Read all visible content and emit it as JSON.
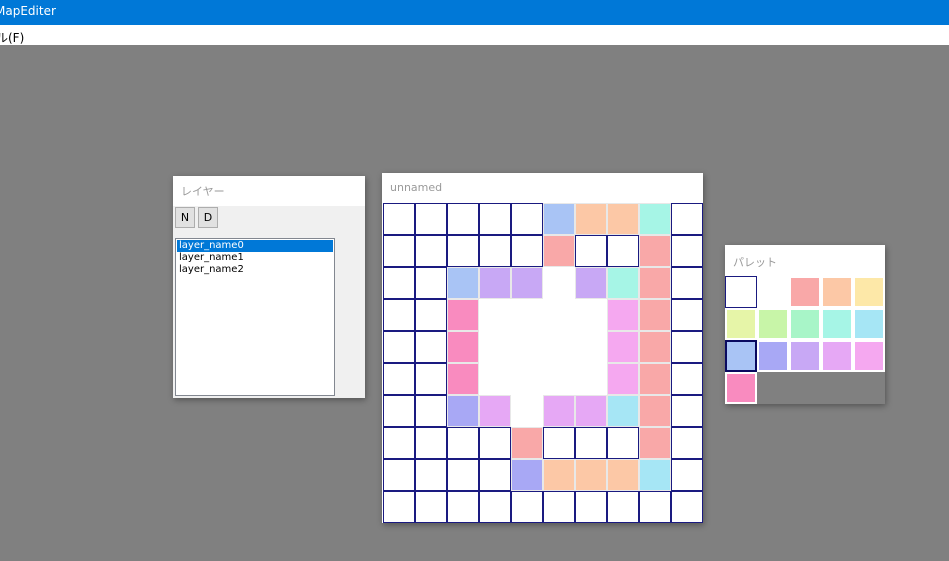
{
  "app": {
    "title": "MapEditer"
  },
  "menu": {
    "file_label": "ル(F)"
  },
  "layer_window": {
    "title": "レイヤー",
    "new_label": "N",
    "delete_label": "D",
    "layers": [
      "layer_name0",
      "layer_name1",
      "layer_name2"
    ],
    "selected_index": 0
  },
  "map_window": {
    "title": "unnamed",
    "grid": [
      [
        "#ffffff",
        "#ffffff",
        "#ffffff",
        "#ffffff",
        "#ffffff",
        "#a9c4f5",
        "#fcc8a6",
        "#fcc8a6",
        "#a6f5e6",
        "#ffffff"
      ],
      [
        "#ffffff",
        "#ffffff",
        "#ffffff",
        "#ffffff",
        "#ffffff",
        "#f9a8a8",
        "#ffffff",
        "#ffffff",
        "#f9a8a8",
        "#ffffff"
      ],
      [
        "#ffffff",
        "#ffffff",
        "#a9c4f5",
        "#c8a8f5",
        "#c8a8f5",
        null,
        "#c8a8f5",
        "#a6f5e6",
        "#f9a8a8",
        "#ffffff"
      ],
      [
        "#ffffff",
        "#ffffff",
        "#f98bbf",
        null,
        null,
        null,
        null,
        "#f5a8f0",
        "#f9a8a8",
        "#ffffff"
      ],
      [
        "#ffffff",
        "#ffffff",
        "#f98bbf",
        null,
        null,
        null,
        null,
        "#f5a8f0",
        "#f9a8a8",
        "#ffffff"
      ],
      [
        "#ffffff",
        "#ffffff",
        "#f98bbf",
        null,
        null,
        null,
        null,
        "#f5a8f0",
        "#f9a8a8",
        "#ffffff"
      ],
      [
        "#ffffff",
        "#ffffff",
        "#a8a8f5",
        "#e6a8f5",
        null,
        "#e6a8f5",
        "#e6a8f5",
        "#a6e6f5",
        "#f9a8a8",
        "#ffffff"
      ],
      [
        "#ffffff",
        "#ffffff",
        "#ffffff",
        "#ffffff",
        "#f9a8a8",
        "#ffffff",
        "#ffffff",
        "#ffffff",
        "#f9a8a8",
        "#ffffff"
      ],
      [
        "#ffffff",
        "#ffffff",
        "#ffffff",
        "#ffffff",
        "#a8a8f5",
        "#fcc8a6",
        "#fcc8a6",
        "#fcc8a6",
        "#a6e6f5",
        "#ffffff"
      ],
      [
        "#ffffff",
        "#ffffff",
        "#ffffff",
        "#ffffff",
        "#ffffff",
        "#ffffff",
        "#ffffff",
        "#ffffff",
        "#ffffff",
        "#ffffff"
      ]
    ]
  },
  "palette_window": {
    "title": "パレット",
    "selected_index": 10,
    "colors": [
      "#ffffff",
      null,
      "#f9a8a8",
      "#fcc8a6",
      "#fde8a8",
      "#e6f5a8",
      "#c8f5a8",
      "#a8f5c8",
      "#a6f5e6",
      "#a6e6f5",
      "#a9c4f5",
      "#a8a8f5",
      "#c8a8f5",
      "#e6a8f5",
      "#f5a8f0",
      "#f98bbf"
    ]
  }
}
